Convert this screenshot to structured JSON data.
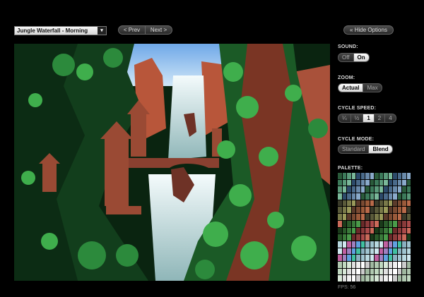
{
  "scene_select": {
    "value": "Jungle Waterfall - Morning",
    "arrow": "▾"
  },
  "pager": {
    "prev_label": "< Prev",
    "next_label": "Next >"
  },
  "hide_options_label": "« Hide Options",
  "sound": {
    "label": "SOUND:",
    "options": [
      "Off",
      "On"
    ],
    "active": 1
  },
  "zoom": {
    "label": "ZOOM:",
    "options": [
      "Actual",
      "Max"
    ],
    "active": 0
  },
  "cycle_speed": {
    "label": "CYCLE SPEED:",
    "options": [
      "¼",
      "½",
      "1",
      "2",
      "4"
    ],
    "active": 2
  },
  "cycle_mode": {
    "label": "CYCLE MODE:",
    "options": [
      "Standard",
      "Blend"
    ],
    "active": 1
  },
  "palette": {
    "label": "PALETTE:"
  },
  "fps": "FPS: 56",
  "colors": {
    "sky": "#9cc8f0",
    "water": "#d8ecf0",
    "foliage_dark": "#0f3a1a",
    "foliage_bright": "#3aa84a",
    "rock": "#8a3c2a",
    "rock_light": "#c46a4a"
  }
}
